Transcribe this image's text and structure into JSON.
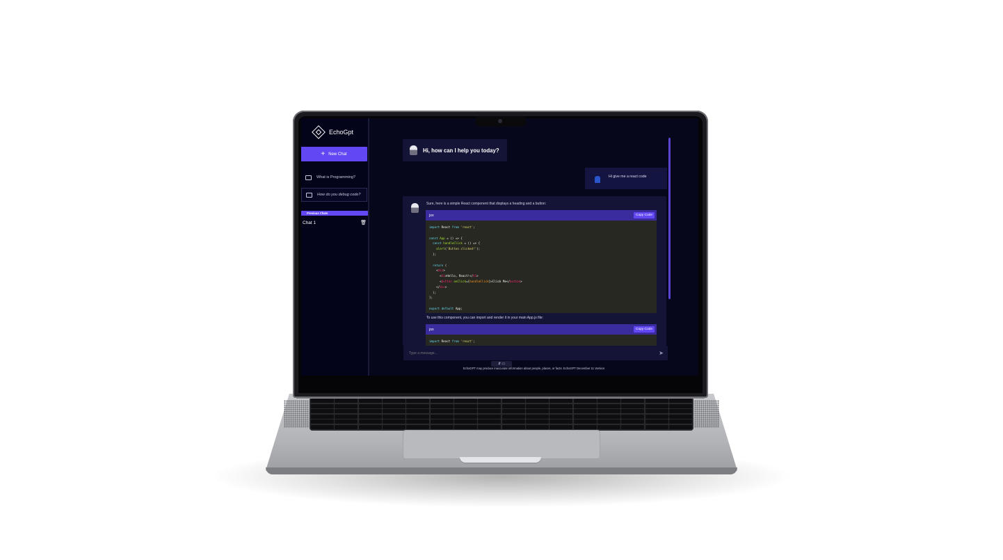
{
  "app": {
    "title": "EchoGpt"
  },
  "sidebar": {
    "new_chat_label": "New Chat",
    "items": [
      {
        "label": "What is Programming?"
      },
      {
        "label": "How do you debug code?"
      }
    ],
    "previous_chats_label": "Previous Chats",
    "chats": [
      {
        "label": "Chat 1"
      }
    ]
  },
  "conversation": {
    "greeting": "Hi, how can I help you today?",
    "user_message": "Hi give me a react code",
    "ai_intro": "Sure, here is a simple React component that displays a heading and a button:",
    "code_blocks": [
      {
        "language": "jsx",
        "copy_label": "Copy Code"
      },
      {
        "language": "jsx",
        "copy_label": "Copy Code"
      }
    ],
    "ai_followup": "To use this component, you can import and render it in your main App.js file:"
  },
  "composer": {
    "placeholder": "Type a message..."
  },
  "footer": {
    "disclaimer": "EchoGPT may produce inaccurate information about people, places, or facts. EchoGPT December 11 Version"
  },
  "colors": {
    "accent": "#6248f5",
    "background": "#05051a",
    "bubble": "#141437"
  }
}
